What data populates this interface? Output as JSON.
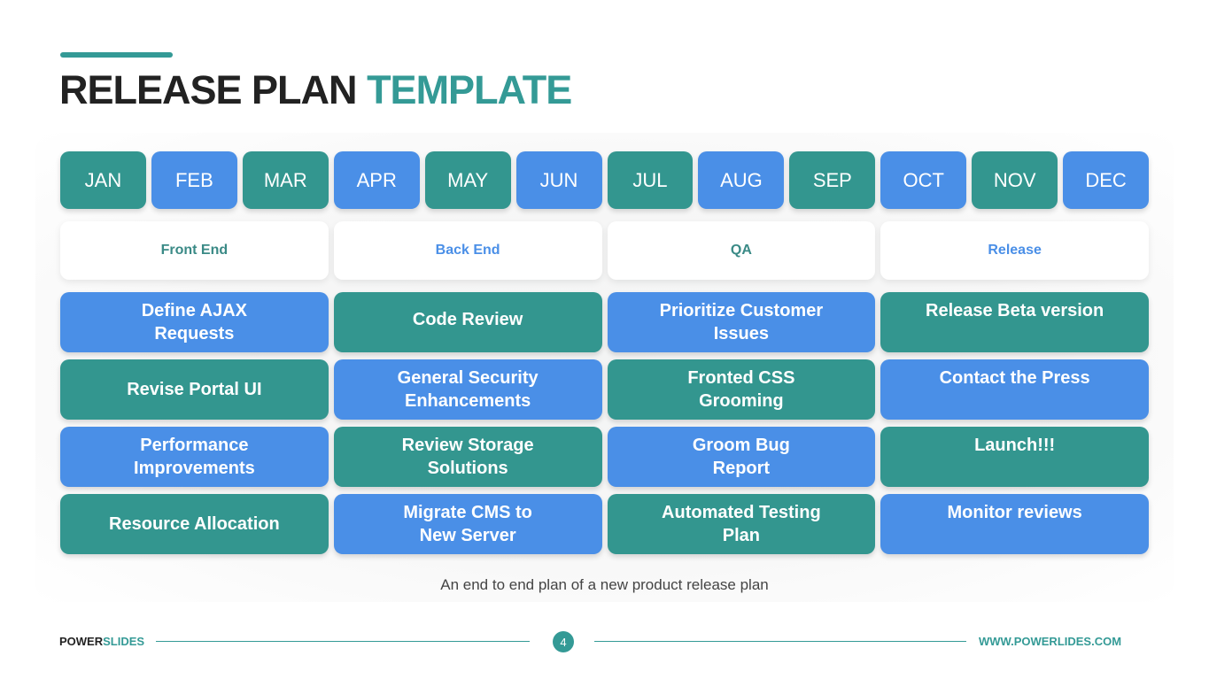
{
  "title": {
    "main": "RELEASE PLAN",
    "accent": "TEMPLATE"
  },
  "colors": {
    "teal": "#33968f",
    "blue": "#4a8fe7",
    "accent": "#349a96",
    "dark": "#222222"
  },
  "months": [
    {
      "label": "JAN",
      "color": "teal"
    },
    {
      "label": "FEB",
      "color": "blue"
    },
    {
      "label": "MAR",
      "color": "teal"
    },
    {
      "label": "APR",
      "color": "blue"
    },
    {
      "label": "MAY",
      "color": "teal"
    },
    {
      "label": "JUN",
      "color": "blue"
    },
    {
      "label": "JUL",
      "color": "teal"
    },
    {
      "label": "AUG",
      "color": "blue"
    },
    {
      "label": "SEP",
      "color": "teal"
    },
    {
      "label": "OCT",
      "color": "blue"
    },
    {
      "label": "NOV",
      "color": "teal"
    },
    {
      "label": "DEC",
      "color": "blue"
    }
  ],
  "phases": [
    {
      "label": "Front End",
      "text_color": "#3a8a86"
    },
    {
      "label": "Back End",
      "text_color": "#4a8fe7"
    },
    {
      "label": "QA",
      "text_color": "#3a8a86"
    },
    {
      "label": "Release",
      "text_color": "#4a8fe7"
    }
  ],
  "tasks": [
    [
      {
        "label": "Define AJAX Requests",
        "color": "blue"
      },
      {
        "label": "Code Review",
        "color": "teal"
      },
      {
        "label": "Prioritize Customer Issues",
        "color": "blue"
      },
      {
        "label": "Release Beta version",
        "color": "teal"
      }
    ],
    [
      {
        "label": "Revise Portal UI",
        "color": "teal"
      },
      {
        "label": "General Security Enhancements",
        "color": "blue"
      },
      {
        "label": "Fronted CSS Grooming",
        "color": "teal"
      },
      {
        "label": "Contact the Press",
        "color": "blue"
      }
    ],
    [
      {
        "label": "Performance Improvements",
        "color": "blue"
      },
      {
        "label": "Review Storage Solutions",
        "color": "teal"
      },
      {
        "label": "Groom Bug Report",
        "color": "blue"
      },
      {
        "label": "Launch!!!",
        "color": "teal"
      }
    ],
    [
      {
        "label": "Resource Allocation",
        "color": "teal"
      },
      {
        "label": "Migrate CMS to New Server",
        "color": "blue"
      },
      {
        "label": "Automated Testing Plan",
        "color": "teal"
      },
      {
        "label": "Monitor reviews",
        "color": "blue"
      }
    ]
  ],
  "subtitle": "An end to end plan of a new product release plan",
  "footer": {
    "brand_main": "POWER",
    "brand_accent": "SLIDES",
    "page_number": "4",
    "url": "WWW.POWERLIDES.COM"
  }
}
